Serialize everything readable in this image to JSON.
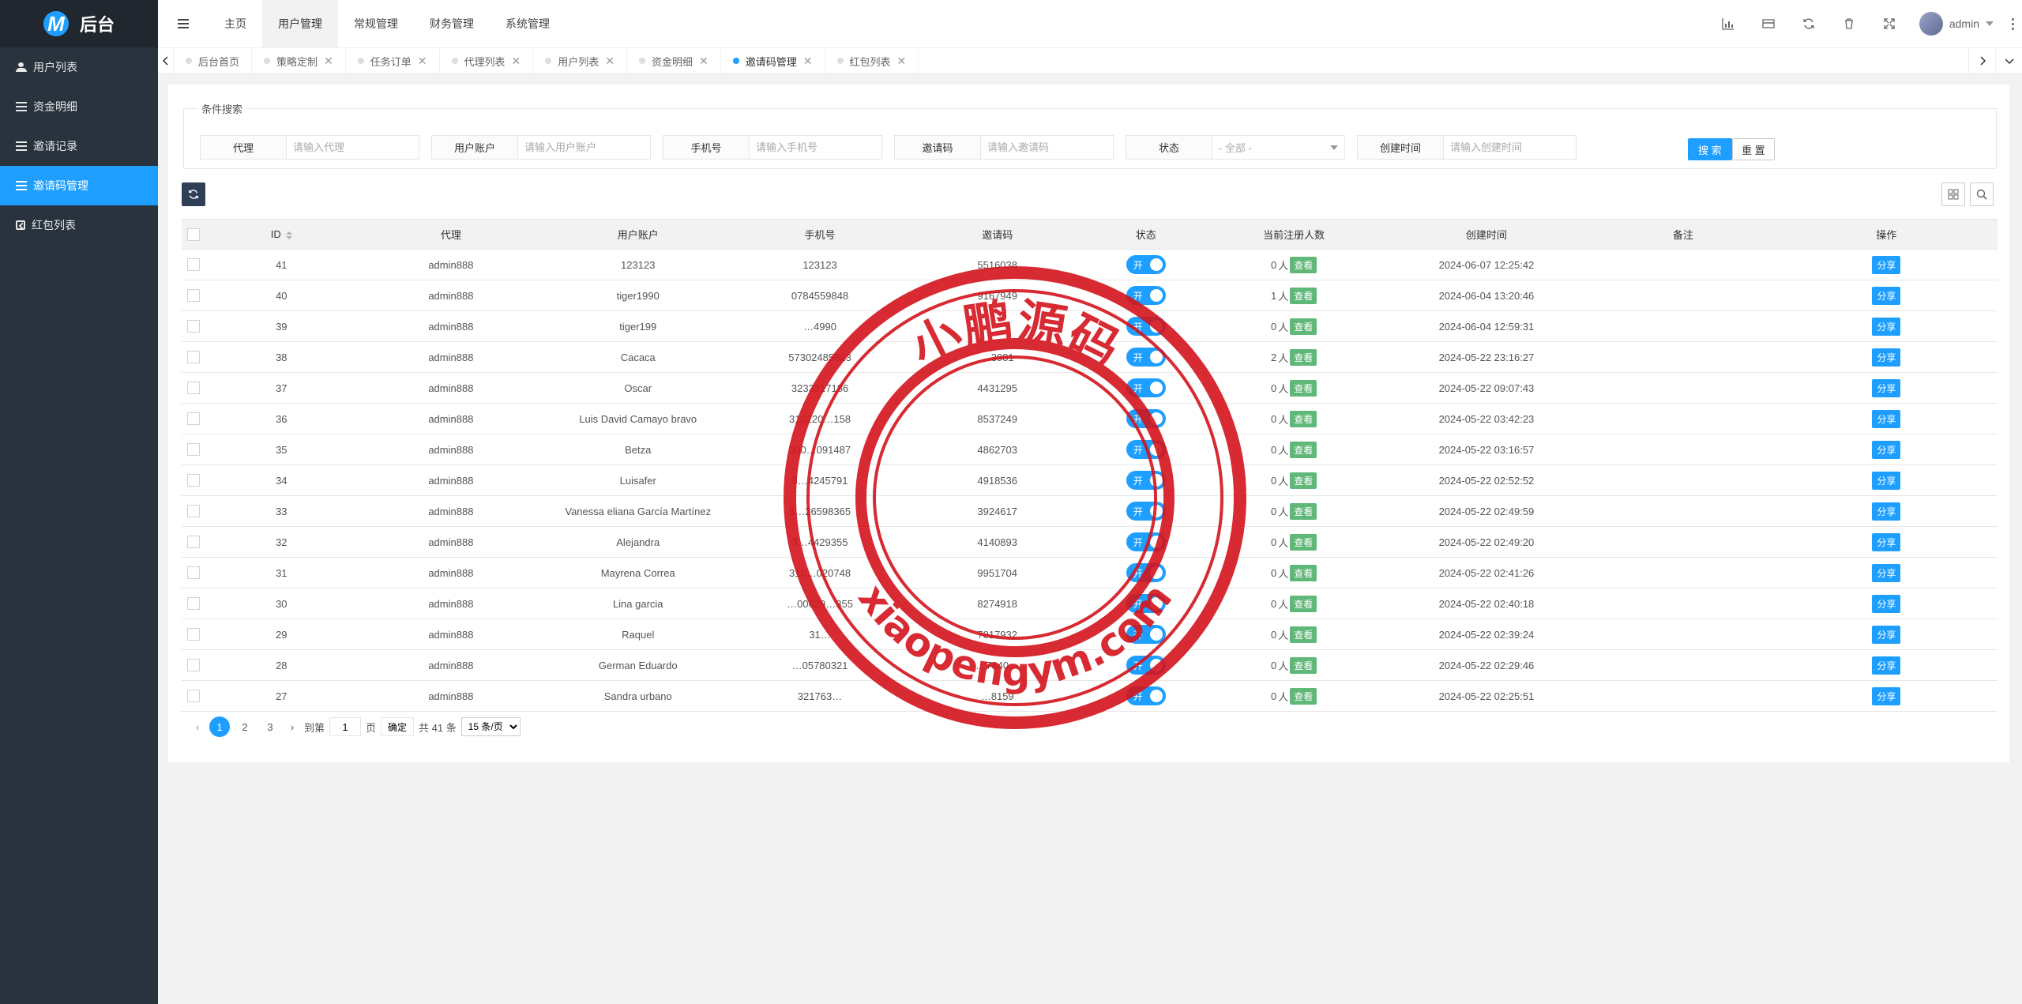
{
  "brand": {
    "logo_letter": "M",
    "title": "后台"
  },
  "sidebar": {
    "items": [
      {
        "label": "用户列表",
        "icon": "users-icon"
      },
      {
        "label": "资金明细",
        "icon": "list-icon"
      },
      {
        "label": "邀请记录",
        "icon": "list-icon"
      },
      {
        "label": "邀请码管理",
        "icon": "list-icon",
        "active": true
      },
      {
        "label": "红包列表",
        "icon": "gift-icon"
      }
    ]
  },
  "header": {
    "nav": [
      "主页",
      "用户管理",
      "常规管理",
      "财务管理",
      "系统管理"
    ],
    "active_nav": 1,
    "username": "admin"
  },
  "tabs": [
    "后台首页",
    "策略定制",
    "任务订单",
    "代理列表",
    "用户列表",
    "资金明细",
    "邀请码管理",
    "红包列表"
  ],
  "active_tab": 6,
  "search": {
    "legend": "条件搜索",
    "fields": [
      {
        "label": "代理",
        "placeholder": "请输入代理"
      },
      {
        "label": "用户账户",
        "placeholder": "请输入用户账户"
      },
      {
        "label": "手机号",
        "placeholder": "请输入手机号"
      },
      {
        "label": "邀请码",
        "placeholder": "请输入邀请码"
      },
      {
        "label": "状态",
        "value": "- 全部 -"
      },
      {
        "label": "创建时间",
        "placeholder": "请输入创建时间"
      }
    ],
    "search_label": "搜 索",
    "reset_label": "重 置"
  },
  "table": {
    "columns": [
      "ID",
      "代理",
      "用户账户",
      "手机号",
      "邀请码",
      "状态",
      "当前注册人数",
      "创建时间",
      "备注",
      "操作"
    ],
    "switch_label": "开",
    "view_label": "查看",
    "share_label": "分享",
    "count_suffix": "人",
    "rows": [
      {
        "id": "41",
        "agent": "admin888",
        "account": "123123",
        "phone": "123123",
        "code": "5516038",
        "count": "0",
        "time": "2024-06-07 12:25:42"
      },
      {
        "id": "40",
        "agent": "admin888",
        "account": "tiger1990",
        "phone": "0784559848",
        "code": "9167949",
        "count": "1",
        "time": "2024-06-04 13:20:46"
      },
      {
        "id": "39",
        "agent": "admin888",
        "account": "tiger199",
        "phone": "…4990",
        "code": "",
        "count": "0",
        "time": "2024-06-04 12:59:31"
      },
      {
        "id": "38",
        "agent": "admin888",
        "account": "Cacaca",
        "phone": "57302485623",
        "code": "…3981",
        "count": "2",
        "time": "2024-05-22 23:16:27"
      },
      {
        "id": "37",
        "agent": "admin888",
        "account": "Oscar",
        "phone": "3233317186",
        "code": "4431295",
        "count": "0",
        "time": "2024-05-22 09:07:43"
      },
      {
        "id": "36",
        "agent": "admin888",
        "account": "Luis David Camayo bravo",
        "phone": "310220…158",
        "code": "8537249",
        "count": "0",
        "time": "2024-05-22 03:42:23"
      },
      {
        "id": "35",
        "agent": "admin888",
        "account": "Betza",
        "phone": "300…091487",
        "code": "4862703",
        "count": "0",
        "time": "2024-05-22 03:16:57"
      },
      {
        "id": "34",
        "agent": "admin888",
        "account": "Luisafer",
        "phone": "3…4245791",
        "code": "4918536",
        "count": "0",
        "time": "2024-05-22 02:52:52"
      },
      {
        "id": "33",
        "agent": "admin888",
        "account": "Vanessa eliana García Martínez",
        "phone": "3…26598365",
        "code": "3924617",
        "count": "0",
        "time": "2024-05-22 02:49:59"
      },
      {
        "id": "32",
        "agent": "admin888",
        "account": "Alejandra",
        "phone": "3…4429355",
        "code": "4140893",
        "count": "0",
        "time": "2024-05-22 02:49:20"
      },
      {
        "id": "31",
        "agent": "admin888",
        "account": "Mayrena Correa",
        "phone": "310…020748",
        "code": "9951704",
        "count": "0",
        "time": "2024-05-22 02:41:26"
      },
      {
        "id": "30",
        "agent": "admin888",
        "account": "Lina garcia",
        "phone": "…00629…355",
        "code": "8274918",
        "count": "0",
        "time": "2024-05-22 02:40:18"
      },
      {
        "id": "29",
        "agent": "admin888",
        "account": "Raquel",
        "phone": "31…",
        "code": "7017932",
        "count": "0",
        "time": "2024-05-22 02:39:24"
      },
      {
        "id": "28",
        "agent": "admin888",
        "account": "German Eduardo",
        "phone": "…05780321",
        "code": "…7840…",
        "count": "0",
        "time": "2024-05-22 02:29:46"
      },
      {
        "id": "27",
        "agent": "admin888",
        "account": "Sandra urbano",
        "phone": "321763…",
        "code": "…8159",
        "count": "0",
        "time": "2024-05-22 02:25:51"
      }
    ]
  },
  "pager": {
    "pages": [
      "1",
      "2",
      "3"
    ],
    "current": "1",
    "goto_label": "到第",
    "goto_value": "1",
    "page_unit": "页",
    "ok_label": "确定",
    "total_label": "共 41 条",
    "size_label": "15 条/页"
  },
  "watermark": {
    "top_text": "小鹏源码",
    "bottom_text": "xiaopengym.com"
  },
  "colors": {
    "accent": "#1e9fff",
    "sidebar": "#28333e",
    "view": "#5fb878",
    "stamp": "#d4141c"
  }
}
